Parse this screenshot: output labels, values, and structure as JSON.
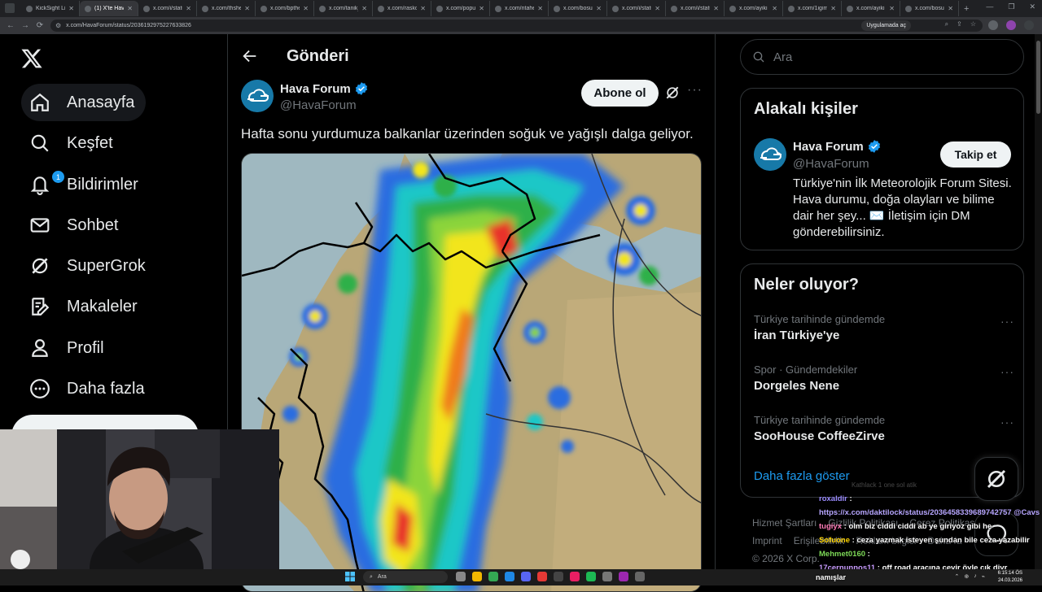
{
  "browser": {
    "tabs": [
      {
        "title": "KickSight Lin"
      },
      {
        "title": "(1) X'te Hava",
        "active": true
      },
      {
        "title": "x.com/i/statu"
      },
      {
        "title": "x.com/thshe"
      },
      {
        "title": "x.com/bpthe"
      },
      {
        "title": "x.com/tanik_"
      },
      {
        "title": "x.com/raskol"
      },
      {
        "title": "x.com/popul"
      },
      {
        "title": "x.com/ntahe"
      },
      {
        "title": "x.com/bosun"
      },
      {
        "title": "x.com/i/statu"
      },
      {
        "title": "x.com/i/statu"
      },
      {
        "title": "x.com/ayiki"
      },
      {
        "title": "x.com/1igim"
      },
      {
        "title": "x.com/ayiki"
      },
      {
        "title": "x.com/bosun"
      }
    ],
    "url": "x.com/HavaForum/status/2036192975227633826",
    "translate_pill": "Uygulamada aç"
  },
  "nav": {
    "items": [
      {
        "label": "Anasayfa",
        "icon": "home-icon"
      },
      {
        "label": "Keşfet",
        "icon": "search-icon"
      },
      {
        "label": "Bildirimler",
        "icon": "bell-icon",
        "badge": "1"
      },
      {
        "label": "Sohbet",
        "icon": "mail-icon"
      },
      {
        "label": "SuperGrok",
        "icon": "grok-icon"
      },
      {
        "label": "Makaleler",
        "icon": "article-icon"
      },
      {
        "label": "Profil",
        "icon": "person-icon"
      },
      {
        "label": "Daha fazla",
        "icon": "more-circle-icon"
      }
    ]
  },
  "post": {
    "page_title": "Gönderi",
    "author_name": "Hava Forum",
    "author_handle": "@HavaForum",
    "subscribe_label": "Abone ol",
    "more": "···",
    "text": "Hafta sonu yurdumuza balkanlar üzerinden soğuk ve yağışlı dalga geliyor."
  },
  "right": {
    "search_placeholder": "Ara",
    "relevant": {
      "title": "Alakalı kişiler",
      "name": "Hava Forum",
      "handle": "@HavaForum",
      "follow_label": "Takip et",
      "bio": "Türkiye'nin İlk Meteorolojik Forum Sitesi. Hava durumu, doğa olayları ve bilime dair her şey... ✉️ İletişim için DM gönderebilirsiniz."
    },
    "trends": {
      "title": "Neler oluyor?",
      "items": [
        {
          "category": "Türkiye tarihinde gündemde",
          "title": "İran Türkiye'ye"
        },
        {
          "category": "Spor · Gündemdekiler",
          "title": "Dorgeles Nene"
        },
        {
          "category": "Türkiye tarihinde gündemde",
          "title": "SooHouse CoffeeZirve"
        }
      ],
      "show_more": "Daha fazla göster"
    },
    "footer": {
      "row1": [
        "Hizmet Şartları",
        "Gizlilik Politikası",
        "Çerez Politikası"
      ],
      "row2": [
        "Imprint",
        "Erişilebilirlik",
        "Reklam bilgisi",
        "Daha fa"
      ],
      "copyright": "© 2026 X Corp."
    }
  },
  "chat": {
    "ghost": "Kathlack 1 one sol atik",
    "lines": [
      {
        "user": "roxaldir",
        "sep": " :",
        "msg": "",
        "color": "#9b8cff"
      },
      {
        "user": "",
        "sep": "",
        "msg": "https://x.com/daktilock/status/2036458339689742757 @Cavs",
        "link": true
      },
      {
        "user": "tugiyx",
        "sep": " : ",
        "msg": "olm biz ciddi ciddi ab ye giriyoz gibi he",
        "color": "#ff7ab6"
      },
      {
        "user": "Sofuone",
        "sep": " : ",
        "msg": "ceza yazmak isteyen şundan bile ceza yazabilir",
        "color": "#ffd400"
      },
      {
        "user": "Mehmet0160",
        "sep": " : ",
        "msg": "",
        "color": "#7dd957"
      },
      {
        "user": "17cernunnos11",
        "sep": " : ",
        "msg": "off road aracına çevir öyle çık diyr",
        "color": "#c99cff"
      }
    ],
    "last": "namışlar"
  },
  "taskbar": {
    "search_placeholder": "Ara",
    "time": "6:15:14 ÖS",
    "date": "24.03.2026"
  }
}
